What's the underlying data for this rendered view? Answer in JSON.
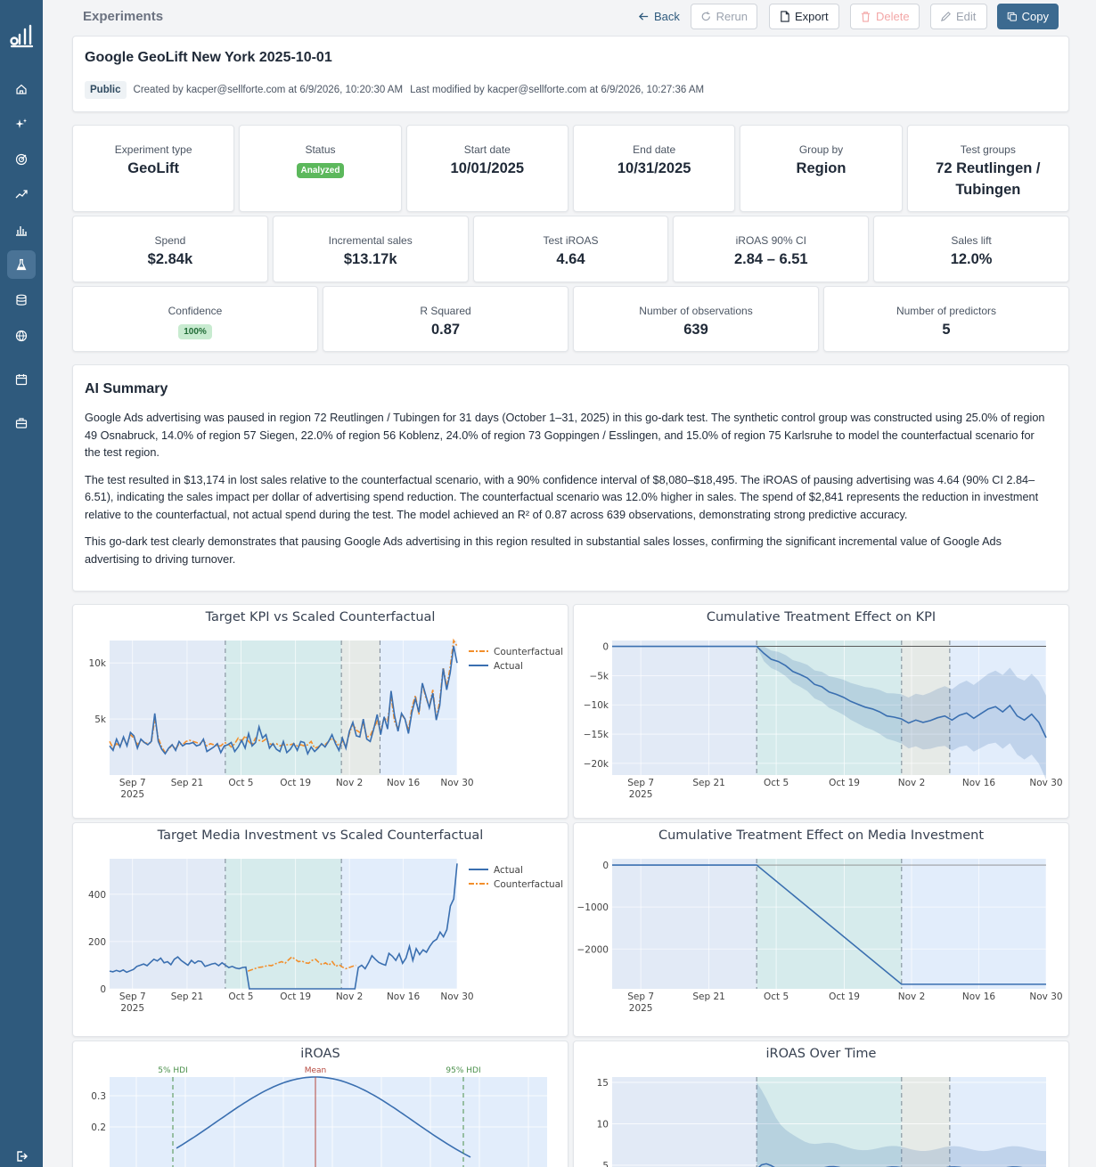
{
  "sidebar": {
    "items": [
      {
        "icon": "home-icon"
      },
      {
        "icon": "sparkles-icon"
      },
      {
        "icon": "target-icon"
      },
      {
        "icon": "trend-up-icon"
      },
      {
        "icon": "bar-chart-icon"
      },
      {
        "icon": "flask-icon",
        "active": true
      },
      {
        "icon": "database-icon"
      },
      {
        "icon": "globe-icon"
      },
      {
        "icon": "calendar-icon"
      },
      {
        "icon": "briefcase-icon"
      }
    ],
    "footer_icon": "logout-icon"
  },
  "topbar": {
    "heading": "Experiments",
    "back": "Back",
    "rerun": "Rerun",
    "export": "Export",
    "delete": "Delete",
    "edit": "Edit",
    "copy": "Copy"
  },
  "header": {
    "title": "Google GeoLift New York 2025-10-01",
    "visibility": "Public",
    "created": "Created by kacper@sellforte.com at 6/9/2026, 10:20:30 AM",
    "modified": "Last modified by kacper@sellforte.com at 6/9/2026, 10:27:36 AM"
  },
  "stats_row1": [
    {
      "label": "Experiment type",
      "value": "GeoLift"
    },
    {
      "label": "Status",
      "badge": "Analyzed"
    },
    {
      "label": "Start date",
      "value": "10/01/2025"
    },
    {
      "label": "End date",
      "value": "10/31/2025"
    },
    {
      "label": "Group by",
      "value": "Region"
    },
    {
      "label": "Test groups",
      "value": "72 Reutlingen / Tubingen"
    }
  ],
  "stats_row2": [
    {
      "label": "Spend",
      "value": "$2.84k"
    },
    {
      "label": "Incremental sales",
      "value": "$13.17k"
    },
    {
      "label": "Test iROAS",
      "value": "4.64"
    },
    {
      "label": "iROAS 90% CI",
      "value": "2.84 – 6.51"
    },
    {
      "label": "Sales lift",
      "value": "12.0%"
    }
  ],
  "stats_row3": [
    {
      "label": "Confidence",
      "badge": "100%"
    },
    {
      "label": "R Squared",
      "value": "0.87"
    },
    {
      "label": "Number of observations",
      "value": "639"
    },
    {
      "label": "Number of predictors",
      "value": "5"
    }
  ],
  "summary": {
    "title": "AI Summary",
    "p1": "Google Ads advertising was paused in region 72 Reutlingen / Tubingen for 31 days (October 1–31, 2025) in this go-dark test. The synthetic control group was constructed using 25.0% of region 49 Osnabruck, 14.0% of region 57 Siegen, 22.0% of region 56 Koblenz, 24.0% of region 73 Goppingen / Esslingen, and 15.0% of region 75 Karlsruhe to model the counterfactual scenario for the test region.",
    "p2": "The test resulted in $13,174 in lost sales relative to the counterfactual scenario, with a 90% confidence interval of $8,080–$18,495. The iROAS of pausing advertising was 4.64 (90% CI 2.84–6.51), indicating the sales impact per dollar of advertising spend reduction. The counterfactual scenario was 12.0% higher in sales. The spend of $2,841 represents the reduction in investment relative to the counterfactual, not actual spend during the test. The model achieved an R² of 0.87 across 639 observations, demonstrating strong predictive accuracy.",
    "p3": "This go-dark test clearly demonstrates that pausing Google Ads advertising in this region resulted in substantial sales losses, confirming the significant incremental value of Google Ads advertising to driving turnover."
  },
  "colors": {
    "actual": "#3a6fb0",
    "counterfactual": "#f28e2b",
    "sidebar": "#2f5a7d",
    "primary": "#3c6a90",
    "green": "#5cb85c"
  },
  "chart_data": [
    {
      "id": "kpi",
      "type": "line",
      "title": "Target KPI vs Scaled Counterfactual",
      "x_ticks": [
        "Sep 7\n2025",
        "Sep 21",
        "Oct 5",
        "Oct 19",
        "Nov 2",
        "Nov 16",
        "Nov 30"
      ],
      "y_ticks": [
        "5k",
        "10k"
      ],
      "ylim": [
        0,
        12000
      ],
      "legend": [
        "Counterfactual",
        "Actual"
      ],
      "legend_position": "top-right",
      "series": [
        {
          "name": "Actual",
          "values": [
            2600,
            2200,
            3200,
            2500,
            3400,
            2600,
            3800,
            3500,
            2400,
            3200,
            2900,
            2700,
            3000,
            5500,
            3000,
            2300,
            1900,
            2400,
            2700,
            2200,
            3000,
            2600,
            2800,
            2800,
            2900,
            2600,
            2700,
            3200,
            2100,
            2300,
            2500,
            2800,
            2000,
            2600,
            2700,
            2900,
            2100,
            2500,
            3100,
            2400,
            3700,
            2600,
            2900,
            4300,
            3300,
            3600,
            2400,
            2800,
            2300,
            2100,
            3000,
            2000,
            2300,
            2800,
            2200,
            3000,
            2900,
            1900,
            2500,
            2100,
            2400,
            2800,
            2500,
            3000,
            3600,
            2800,
            2200,
            3300,
            2400,
            3900,
            4700,
            3500,
            3400,
            5000,
            3200,
            3000,
            4100,
            5400,
            3600,
            5200,
            4100,
            7500,
            5300,
            3900,
            5500,
            5000,
            3700,
            5600,
            6800,
            5600,
            8200,
            7100,
            6000,
            7300,
            4900,
            6200,
            9500,
            7600,
            9100,
            11500,
            10000
          ]
        },
        {
          "name": "Counterfactual",
          "values": [
            3000,
            2400,
            2800,
            2600,
            3300,
            2700,
            3600,
            3300,
            2700,
            3100,
            2900,
            2800,
            2900,
            5000,
            3300,
            2500,
            2000,
            2300,
            2700,
            2300,
            2800,
            2700,
            3000,
            3100,
            3000,
            2900,
            2800,
            3100,
            2600,
            2800,
            2700,
            2600,
            2600,
            2900,
            2800,
            2500,
            2800,
            3300,
            3000,
            3500,
            3000,
            2700,
            3300,
            3100,
            3000,
            3200,
            2800,
            2700,
            2800,
            2600,
            2700,
            2700,
            2700,
            2800,
            2600,
            2700,
            2600,
            2700,
            3000,
            2400,
            2500,
            2700,
            2700,
            3000,
            3300,
            3000,
            2600,
            3000,
            2500,
            3700,
            4600,
            4000,
            3800,
            4600,
            3400,
            3500,
            4200,
            4800,
            4000,
            5100,
            4800,
            7000,
            4800,
            4100,
            5400,
            5000,
            4000,
            6000,
            7100,
            5400,
            8100,
            6900,
            6100,
            7600,
            5000,
            6600,
            9600,
            7800,
            9600,
            12000,
            11500
          ]
        }
      ]
    },
    {
      "id": "cum_kpi",
      "type": "line",
      "title": "Cumulative Treatment Effect on KPI",
      "x_ticks": [
        "Sep 7\n2025",
        "Sep 21",
        "Oct 5",
        "Oct 19",
        "Nov 2",
        "Nov 16",
        "Nov 30"
      ],
      "y_ticks": [
        "0",
        "−5k",
        "−10k",
        "−15k",
        "−20k"
      ],
      "ylim": [
        -22000,
        1000
      ],
      "series": [
        {
          "name": "Effect",
          "values": [
            0,
            -1200,
            -2200,
            -2600,
            -3300,
            -4300,
            -4800,
            -5400,
            -6500,
            -6900,
            -7800,
            -8200,
            -8700,
            -9400,
            -9900,
            -10400,
            -10700,
            -11200,
            -11900,
            -12100,
            -12400,
            -13100,
            -12600,
            -13000,
            -12700,
            -12200,
            -11900,
            -12600,
            -11800,
            -11400,
            -12300,
            -11500,
            -10700,
            -10300,
            -11200,
            -10100,
            -11900,
            -12600,
            -11600,
            -13000,
            -15600
          ]
        }
      ]
    },
    {
      "id": "media",
      "type": "line",
      "title": "Target Media Investment vs Scaled Counterfactual",
      "x_ticks": [
        "Sep 7\n2025",
        "Sep 21",
        "Oct 5",
        "Oct 19",
        "Nov 2",
        "Nov 16",
        "Nov 30"
      ],
      "y_ticks": [
        "0",
        "200",
        "400"
      ],
      "ylim": [
        0,
        550
      ],
      "legend": [
        "Actual",
        "Counterfactual"
      ],
      "legend_position": "top-right",
      "series": [
        {
          "name": "Actual",
          "values": [
            75,
            72,
            78,
            73,
            80,
            70,
            76,
            82,
            95,
            100,
            105,
            98,
            112,
            125,
            118,
            130,
            110,
            115,
            102,
            125,
            135,
            120,
            110,
            100,
            120,
            108,
            118,
            115,
            95,
            100,
            105,
            108,
            98,
            110,
            100,
            90,
            95,
            88,
            85,
            90,
            92,
            0,
            0,
            0,
            0,
            0,
            0,
            0,
            0,
            0,
            0,
            0,
            0,
            0,
            0,
            0,
            0,
            0,
            0,
            0,
            0,
            0,
            0,
            0,
            0,
            0,
            0,
            0,
            0,
            0,
            0,
            0,
            0,
            90,
            100,
            85,
            110,
            140,
            125,
            112,
            105,
            100,
            150,
            138,
            120,
            148,
            108,
            130,
            180,
            120,
            170,
            145,
            165,
            155,
            180,
            200,
            210,
            240,
            220,
            250,
            350,
            380,
            530
          ]
        },
        {
          "name": "Counterfactual",
          "values": [
            null,
            null,
            null,
            null,
            null,
            null,
            null,
            null,
            null,
            null,
            null,
            null,
            null,
            null,
            null,
            null,
            null,
            null,
            null,
            null,
            null,
            null,
            null,
            null,
            null,
            null,
            null,
            null,
            null,
            null,
            null,
            null,
            null,
            null,
            null,
            null,
            null,
            null,
            null,
            null,
            null,
            75,
            80,
            85,
            90,
            92,
            95,
            100,
            98,
            105,
            110,
            115,
            108,
            122,
            135,
            125,
            115,
            118,
            110,
            108,
            120,
            125,
            112,
            102,
            110,
            100,
            115,
            95,
            102,
            92,
            85,
            90,
            95,
            100,
            null,
            null,
            null,
            null,
            null,
            null,
            null,
            null,
            null,
            null,
            null,
            null,
            null,
            null,
            null,
            null,
            null,
            null,
            null,
            null,
            null,
            null,
            null,
            null,
            null,
            null,
            null,
            null,
            null,
            null
          ]
        }
      ]
    },
    {
      "id": "cum_media",
      "type": "line",
      "title": "Cumulative Treatment Effect on Media Investment",
      "x_ticks": [
        "Sep 7\n2025",
        "Sep 21",
        "Oct 5",
        "Oct 19",
        "Nov 2",
        "Nov 16",
        "Nov 30"
      ],
      "y_ticks": [
        "0",
        "−1000",
        "−2000"
      ],
      "ylim": [
        -2950,
        150
      ],
      "series": [
        {
          "name": "Effect",
          "values": [
            0,
            -2841,
            -2841
          ]
        }
      ]
    },
    {
      "id": "iroas_dist",
      "type": "area",
      "title": "iROAS",
      "y_ticks": [
        "0.2",
        "0.3"
      ],
      "annotations": [
        "5% HDI",
        "Mean",
        "95% HDI"
      ]
    },
    {
      "id": "iroas_time",
      "type": "line",
      "title": "iROAS Over Time",
      "y_ticks": [
        "5",
        "10",
        "15"
      ],
      "ylim": [
        0,
        16
      ]
    }
  ]
}
